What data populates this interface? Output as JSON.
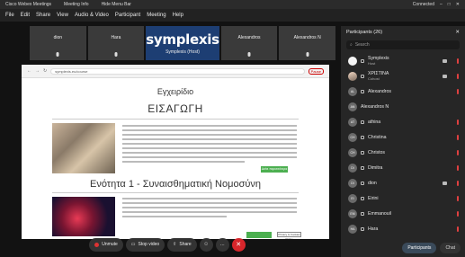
{
  "window": {
    "title": "Cisco Webex Meetings",
    "meeting_info": "Meeting Info",
    "hide_menu": "Hide Menu Bar",
    "status": "Connected"
  },
  "menu": [
    "File",
    "Edit",
    "Share",
    "View",
    "Audio & Video",
    "Participant",
    "Meeting",
    "Help"
  ],
  "tiles": [
    {
      "name": "dion"
    },
    {
      "name": "Hara"
    },
    {
      "brand": "symplexis",
      "name": "Symplexis (Host)"
    },
    {
      "name": "Alexandros"
    },
    {
      "name": "Alexandros N"
    }
  ],
  "share": {
    "url": "symplexis.eu/course",
    "record_label": "Pause",
    "heading_small": "Εγχειρίδιο",
    "heading_intro": "ΕΙΣΑΓΩΓΗ",
    "button_1": "Δείτε περισσότερα",
    "section_title": "Ενότητα 1 - Συναισθηματική Νομοσύνη",
    "popup": "Privacy & Cookies Policy"
  },
  "toolbar": {
    "unmute": "Unmute",
    "stop_video": "Stop video",
    "share": "Share",
    "more": "...",
    "end": "✕"
  },
  "panel": {
    "title": "Participants (26)",
    "search_placeholder": "Search",
    "participants": [
      {
        "name": "Symplexis",
        "role": "Host",
        "avatar": ""
      },
      {
        "name": "ΧΡΙΣΤΙΝΑ",
        "role": "Cohost",
        "avatar": ""
      },
      {
        "name": "Alexandros",
        "avatar": "AL"
      },
      {
        "name": "Alexandros N",
        "avatar": "AN"
      },
      {
        "name": "athina",
        "avatar": "AT"
      },
      {
        "name": "Christina",
        "avatar": "CH"
      },
      {
        "name": "Christos",
        "avatar": "CH"
      },
      {
        "name": "Dimitra",
        "avatar": "DI"
      },
      {
        "name": "dion",
        "avatar": "DI"
      },
      {
        "name": "Eirini",
        "avatar": "EI"
      },
      {
        "name": "Emmanouil",
        "avatar": "EM"
      },
      {
        "name": "Hara",
        "avatar": "HA"
      }
    ],
    "footer_participants": "Participants",
    "footer_chat": "Chat"
  },
  "colors": {
    "end_button": "#d7262b",
    "logo_tile": "#1d3e73",
    "muted_mic": "#e04040"
  }
}
